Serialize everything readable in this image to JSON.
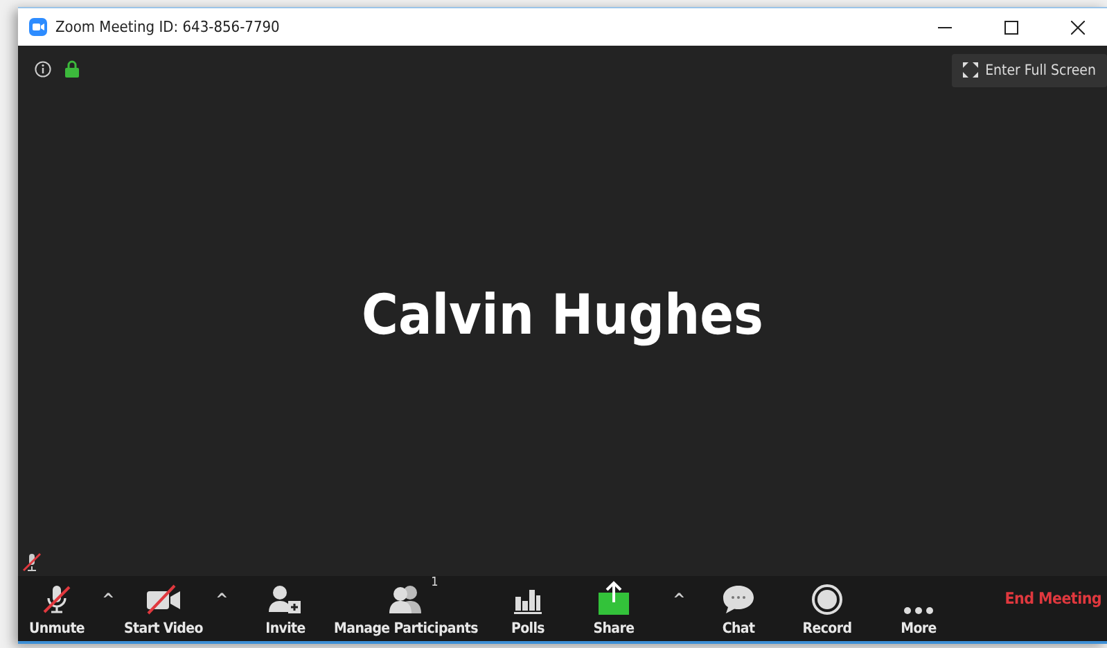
{
  "window": {
    "title": "Zoom Meeting ID: 643-856-7790"
  },
  "top_bar": {
    "encrypted": true,
    "fullscreen_button": "Enter Full Screen"
  },
  "stage": {
    "participant_name": "Calvin Hughes",
    "participant_muted": true
  },
  "toolbar": [
    {
      "kind": "audio",
      "label": "Unmute",
      "off": true
    },
    {
      "kind": "caret",
      "label": "^"
    },
    {
      "kind": "video",
      "label": "Start Video",
      "off": true
    },
    {
      "kind": "caret",
      "label": "^"
    },
    {
      "kind": "invite",
      "label": "Invite"
    },
    {
      "kind": "participants",
      "label": "Manage Participants",
      "count": "1"
    },
    {
      "kind": "polls",
      "label": "Polls"
    },
    {
      "kind": "share",
      "label": "Share"
    },
    {
      "kind": "caret",
      "label": "^"
    },
    {
      "kind": "chat",
      "label": "Chat"
    },
    {
      "kind": "record",
      "label": "Record"
    },
    {
      "kind": "more",
      "label": "More"
    },
    {
      "kind": "end",
      "label": "End Meeting"
    }
  ]
}
